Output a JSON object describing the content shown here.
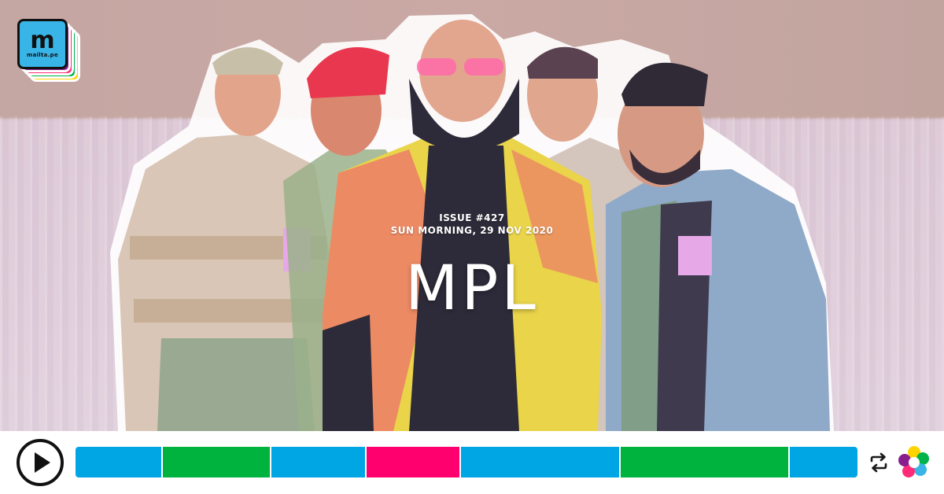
{
  "brand": {
    "glyph": "m",
    "wordmark": "mailta.pe",
    "colors": [
      "#ffd400",
      "#00b34a",
      "#ff2b79",
      "#8a1d8e",
      "#39b4e6"
    ]
  },
  "issue": {
    "label": "ISSUE #427",
    "date": "SUN MORNING, 29 NOV 2020",
    "artist": "MPL"
  },
  "player": {
    "play_icon": "play-icon",
    "repeat_icon": "repeat-icon",
    "brand_icon": "flower-logo-icon",
    "segments": [
      {
        "color": "#00a5e3",
        "weight": 110
      },
      {
        "color": "#00b33f",
        "weight": 138
      },
      {
        "color": "#00a5e3",
        "weight": 120
      },
      {
        "color": "#ff006e",
        "weight": 120
      },
      {
        "color": "#00a5e3",
        "weight": 203
      },
      {
        "color": "#00b33f",
        "weight": 216
      },
      {
        "color": "#00a5e3",
        "weight": 87
      }
    ]
  }
}
